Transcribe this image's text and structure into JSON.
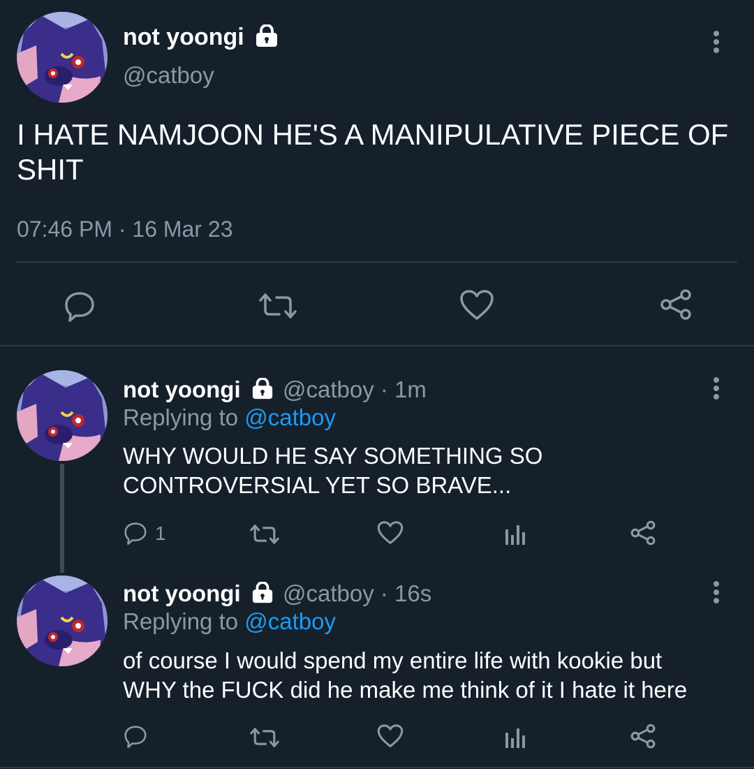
{
  "main_tweet": {
    "display_name": "not yoongi",
    "handle": "@catboy",
    "text_line1": "I HATE NAMJOON HE'S A MANIPULATIVE PIECE OF",
    "text_line2": "SHIT",
    "timestamp": "07:46 PM · 16 Mar 23",
    "actions": [
      "reply-icon",
      "retweet-icon",
      "like-icon",
      "share-icon"
    ]
  },
  "replies": [
    {
      "display_name": "not yoongi",
      "handle_time": "@catboy · 1m",
      "replying_prefix": "Replying to ",
      "replying_to": "@catboy",
      "text_line1": "WHY WOULD HE SAY SOMETHING SO",
      "text_line2": "CONTROVERSIAL YET SO BRAVE...",
      "reply_count": "1"
    },
    {
      "display_name": "not yoongi",
      "handle_time": "@catboy · 16s",
      "replying_prefix": "Replying to ",
      "replying_to": "@catboy",
      "text_line1": "of course I would spend my entire life with kookie but",
      "text_line2": "WHY the FUCK did he make me think of it I hate it here",
      "reply_count": ""
    }
  ],
  "colors": {
    "background": "#15202b",
    "text": "#ffffff",
    "muted": "#8b98a5",
    "link": "#1d9bf0",
    "divider": "#2f3b47"
  }
}
